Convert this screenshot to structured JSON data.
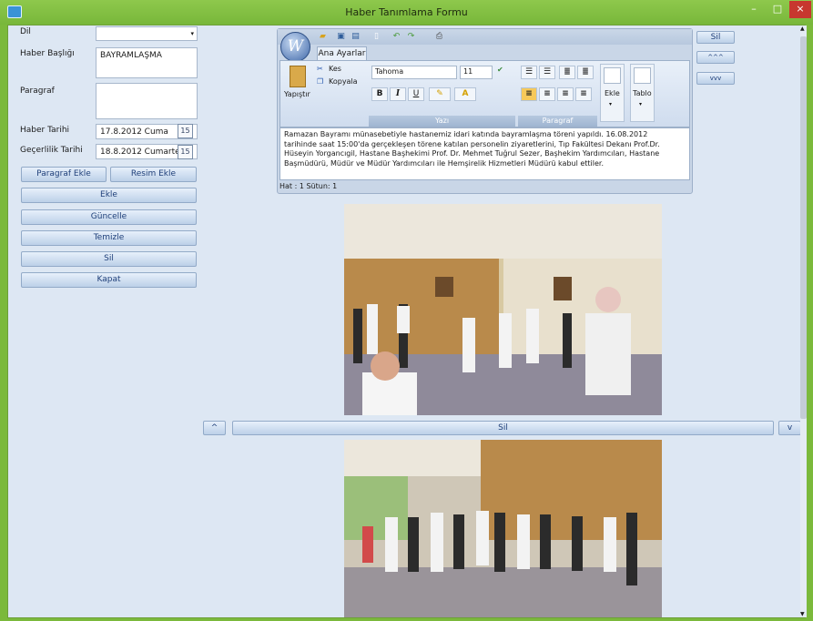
{
  "window": {
    "title": "Haber Tanımlama Formu",
    "min": "–",
    "max": "□",
    "close": "×"
  },
  "form": {
    "dil_label": "Dil",
    "dil_value": "",
    "baslik_label": "Haber Başlığı",
    "baslik_value": "BAYRAMLAŞMA",
    "paragraf_label": "Paragraf",
    "paragraf_value": "",
    "tarih_label": "Haber Tarihi",
    "tarih_value": "17.8.2012 Cuma",
    "gecerlilik_label": "Geçerlilik Tarihi",
    "gecerlilik_value": "18.8.2012 Cumartesi",
    "cal_icon": "15"
  },
  "buttons": {
    "paragraf_ekle": "Paragraf Ekle",
    "resim_ekle": "Resim Ekle",
    "ekle": "Ekle",
    "guncelle": "Güncelle",
    "temizle": "Temizle",
    "sil": "Sil",
    "kapat": "Kapat"
  },
  "editor": {
    "tab": "Ana Ayarlar",
    "orb": "W",
    "yapistir": "Yapıştır",
    "kes": "Kes",
    "kopyala": "Kopyala",
    "font": "Tahoma",
    "size": "11",
    "yazi": "Yazı",
    "paragraf": "Paragraf",
    "ekle": "Ekle",
    "tablo": "Tablo",
    "text": "Ramazan Bayramı münasebetiyle hastanemiz idari katında bayramlaşma töreni yapıldı. 16.08.2012 tarihinde saat 15:00'da gerçekleşen törene katılan personelin ziyaretlerini, Tıp Fakültesi Dekanı Prof.Dr. Hüseyin Yorgancıgil, Hastane Başhekimi Prof. Dr. Mehmet Tuğrul Sezer, Başhekim Yardımcıları, Hastane Başmüdürü, Müdür ve Müdür Yardımcıları ile Hemşirelik Hizmetleri Müdürü kabul ettiler.",
    "status": "Hat : 1 Sütun: 1"
  },
  "side": {
    "sil": "Sil",
    "up": "^^^",
    "down": "vvv"
  },
  "image_bar": {
    "up": "^",
    "sil": "Sil",
    "down": "v"
  },
  "colors": {
    "titlebar": "#7bb93b",
    "client": "#dde7f3",
    "close": "#c7372f"
  }
}
